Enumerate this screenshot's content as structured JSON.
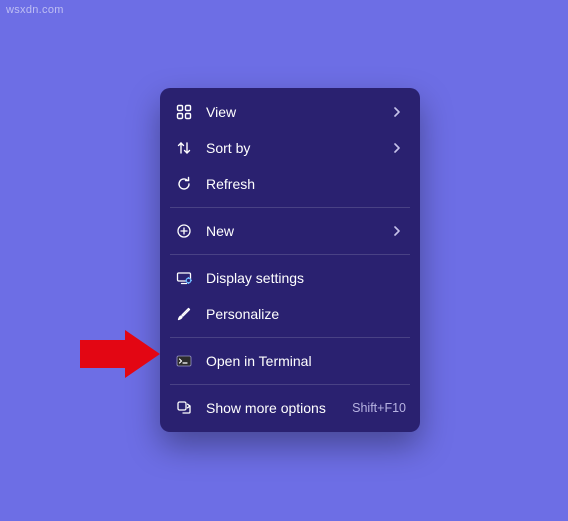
{
  "watermark": "wsxdn.com",
  "menu": {
    "view": {
      "label": "View"
    },
    "sort_by": {
      "label": "Sort by"
    },
    "refresh": {
      "label": "Refresh"
    },
    "new": {
      "label": "New"
    },
    "display_settings": {
      "label": "Display settings"
    },
    "personalize": {
      "label": "Personalize"
    },
    "open_terminal": {
      "label": "Open in Terminal"
    },
    "show_more": {
      "label": "Show more options",
      "shortcut": "Shift+F10"
    }
  }
}
